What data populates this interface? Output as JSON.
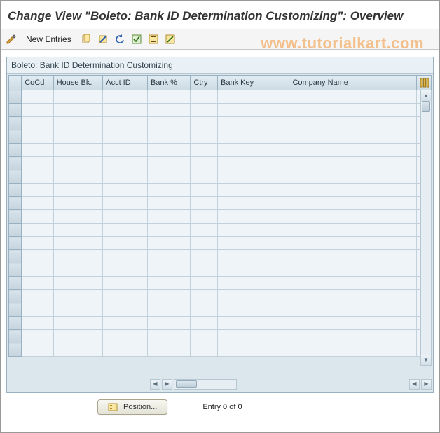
{
  "title": "Change View \"Boleto: Bank ID Determination Customizing\": Overview",
  "watermark": "www.tutorialkart.com",
  "toolbar": {
    "new_entries_label": "New Entries"
  },
  "panel": {
    "title": "Boleto: Bank ID Determination Customizing"
  },
  "columns": {
    "cocd": "CoCd",
    "house_bk": "House Bk.",
    "acct_id": "Acct ID",
    "bank_pct": "Bank %",
    "ctry": "Ctry",
    "bank_key": "Bank Key",
    "company_name": "Company Name"
  },
  "rows_count": 20,
  "footer": {
    "position_label": "Position...",
    "entry_text": "Entry 0 of 0"
  }
}
